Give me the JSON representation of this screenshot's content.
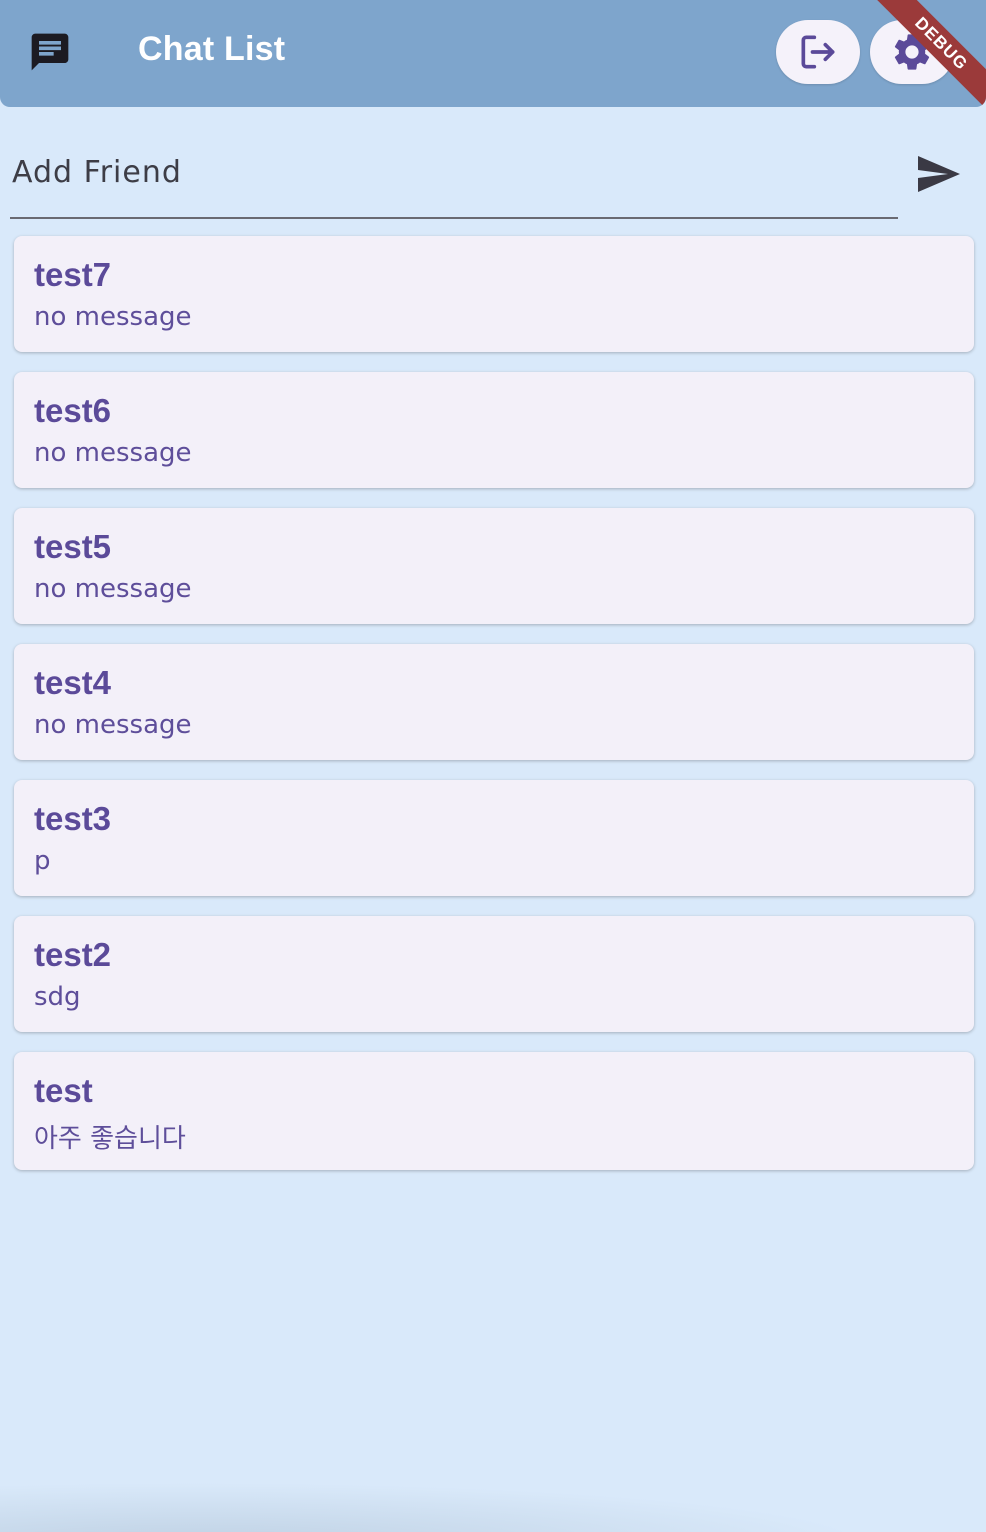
{
  "appbar": {
    "title": "Chat List",
    "icons": {
      "leading": "chat-bubble-icon",
      "logout": "logout-icon",
      "settings": "gear-icon"
    },
    "color": "#7ea5cc"
  },
  "debug_banner": "DEBUG",
  "add_friend": {
    "placeholder": "Add Friend",
    "value": "",
    "send_icon": "send-icon"
  },
  "chats": [
    {
      "name": "test7",
      "last_message": "no message"
    },
    {
      "name": "test6",
      "last_message": "no message"
    },
    {
      "name": "test5",
      "last_message": "no message"
    },
    {
      "name": "test4",
      "last_message": "no message"
    },
    {
      "name": "test3",
      "last_message": "p"
    },
    {
      "name": "test2",
      "last_message": "sdg"
    },
    {
      "name": "test",
      "last_message": "아주 좋습니다"
    }
  ],
  "colors": {
    "background": "#d9e9fa",
    "card": "#f3f0f9",
    "accent": "#5b4a99"
  }
}
